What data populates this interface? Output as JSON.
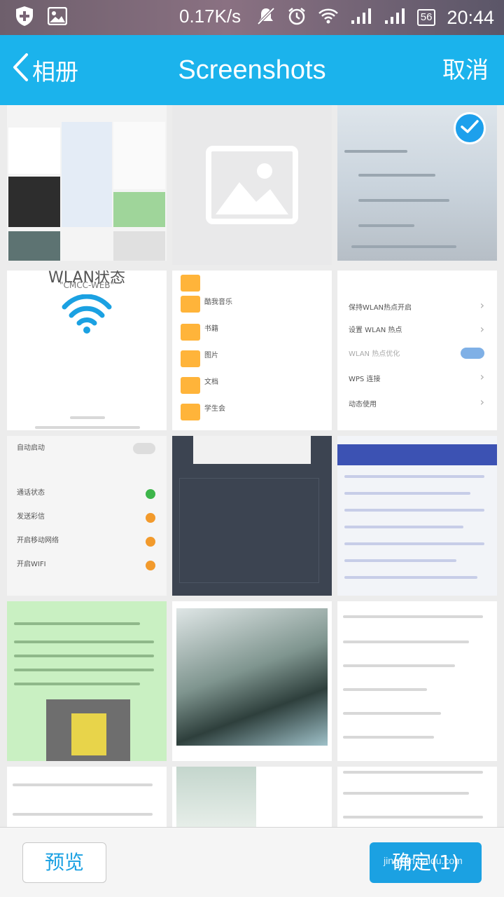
{
  "status_bar": {
    "net_speed": "0.17K/s",
    "battery": "56",
    "time": "20:44"
  },
  "header": {
    "back_label": "相册",
    "title": "Screenshots",
    "cancel_label": "取消"
  },
  "thumbnails": {
    "c4": {
      "title": "WLAN状态",
      "subtitle": "\"CMCC-WEB\""
    },
    "c5": {
      "folders": [
        "酷我音乐",
        "书籍",
        "图片",
        "文档",
        "学生会"
      ]
    },
    "c6": {
      "rows": [
        "保持WLAN热点开启",
        "设置 WLAN 热点",
        "WLAN 热点优化",
        "WPS 连接",
        "动态使用"
      ]
    },
    "c7": {
      "rows": [
        "自动启动",
        "通话状态",
        "发送彩信",
        "开启移动网络",
        "开启WIFI"
      ]
    }
  },
  "footer": {
    "preview_label": "预览",
    "confirm_label": "确定(1)",
    "watermark": "jingyan.baidu.com"
  }
}
